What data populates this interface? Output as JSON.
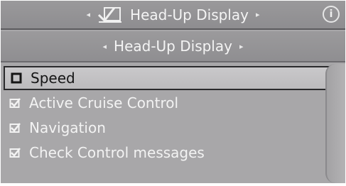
{
  "header": {
    "title": "Head-Up Display",
    "icon": "hud-check-icon",
    "info_icon_glyph": "i"
  },
  "subheader": {
    "title": "Head-Up Display"
  },
  "arrows": {
    "left": "◂",
    "right": "▸"
  },
  "options": [
    {
      "label": "Speed",
      "checked": false,
      "selected": true
    },
    {
      "label": "Active Cruise Control",
      "checked": true,
      "selected": false
    },
    {
      "label": "Navigation",
      "checked": true,
      "selected": false
    },
    {
      "label": "Check Control messages",
      "checked": true,
      "selected": false
    }
  ],
  "colors": {
    "background": "#a8a7a9",
    "text": "#f3f3f3",
    "selected_background": "#c4c3c5",
    "selected_text": "#151515"
  }
}
